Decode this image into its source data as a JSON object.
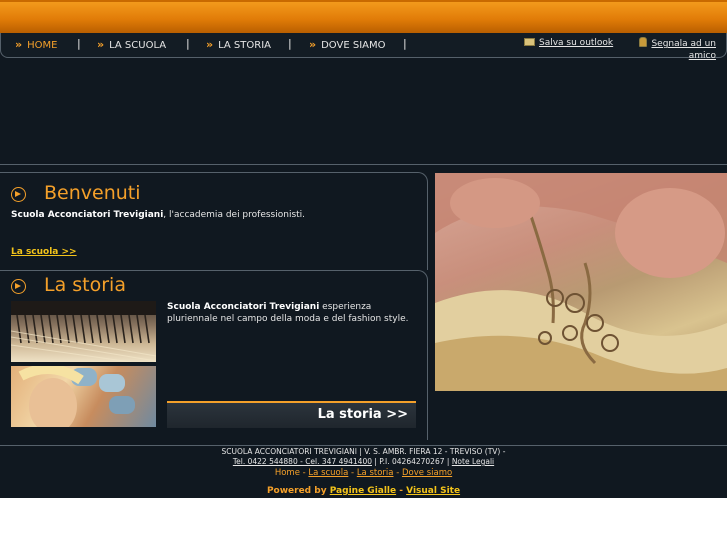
{
  "nav": {
    "items": [
      {
        "label": "HOME"
      },
      {
        "label": "LA SCUOLA"
      },
      {
        "label": "LA STORIA"
      },
      {
        "label": "DOVE SIAMO"
      }
    ],
    "separator": "|",
    "chevron": "»",
    "save_outlook": "Salva su outlook",
    "share_friend": "Segnala ad un amico"
  },
  "welcome": {
    "title": "Benvenuti",
    "text_bold": "Scuola Acconciatori Trevigiani",
    "text_rest": ", l'accademia dei professionisti.",
    "link": "La scuola >>"
  },
  "storia": {
    "title": "La storia",
    "text_bold": "Scuola Acconciatori Trevigiani",
    "text_rest": " esperienza pluriennale nel campo della moda e del fashion style.",
    "cta": "La storia >>"
  },
  "footer": {
    "line1": "SCUOLA ACCONCIATORI TREVIGIANI | V. S. AMBR. FIERA 12 - TREVISO (TV) -",
    "phone": "Tel. 0422 544880 - Cel. 347 4941400",
    "piva": " | P.I. 04264270267 | ",
    "note": "Note Legali",
    "links": [
      "Home",
      "La scuola",
      "La storia",
      "Dove siamo"
    ],
    "powered_by": "Powered by",
    "pagine_gialle": "Pagine Gialle",
    "visual_site": "Visual Site"
  },
  "colors": {
    "accent": "#f4a02a",
    "link": "#f4c41a",
    "background": "#101820"
  }
}
